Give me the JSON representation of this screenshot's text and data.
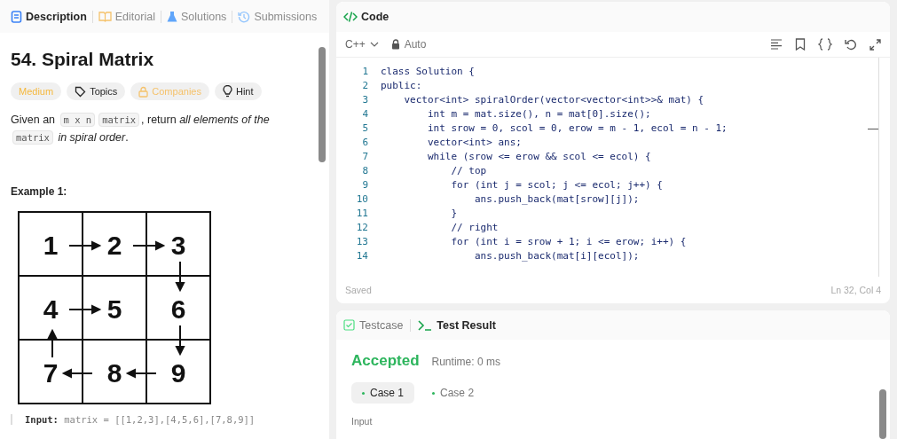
{
  "left_tabs": [
    {
      "label": "Description",
      "selected": true
    },
    {
      "label": "Editorial",
      "selected": false
    },
    {
      "label": "Solutions",
      "selected": false
    },
    {
      "label": "Submissions",
      "selected": false
    }
  ],
  "problem": {
    "title": "54. Spiral Matrix",
    "tags": [
      {
        "label": "Medium",
        "kind": "difficulty"
      },
      {
        "label": "Topics",
        "kind": "tag"
      },
      {
        "label": "Companies",
        "kind": "locked"
      },
      {
        "label": "Hint",
        "kind": "hint"
      }
    ],
    "statement": [
      {
        "t": "Given an ",
        "kind": "text"
      },
      {
        "t": "m x n",
        "kind": "code"
      },
      {
        "t": "matrix",
        "kind": "code"
      },
      {
        "t": ", return ",
        "kind": "text"
      },
      {
        "t": "all elements of the ",
        "kind": "em"
      },
      {
        "t": "matrix",
        "kind": "code"
      },
      {
        "t": " in spiral order",
        "kind": "em"
      },
      {
        "t": ".",
        "kind": "text"
      }
    ],
    "example_title": "Example 1:",
    "matrix": [
      "1",
      "2",
      "3",
      "4",
      "5",
      "6",
      "7",
      "8",
      "9"
    ],
    "input_label": "Input:",
    "input_value": "matrix = [[1,2,3],[4,5,6],[7,8,9]]"
  },
  "code_panel": {
    "title": "Code",
    "language": "C++",
    "mode": "Auto",
    "status": "Saved",
    "cursor": "Ln 32, Col 4",
    "lines": [
      {
        "n": "1",
        "text": "class Solution {"
      },
      {
        "n": "2",
        "text": "public:"
      },
      {
        "n": "3",
        "text": "    vector<int> spiralOrder(vector<vector<int>>& mat) {"
      },
      {
        "n": "4",
        "text": "        int m = mat.size(), n = mat[0].size();"
      },
      {
        "n": "5",
        "text": "        int srow = 0, scol = 0, erow = m - 1, ecol = n - 1;"
      },
      {
        "n": "6",
        "text": "        vector<int> ans;"
      },
      {
        "n": "7",
        "text": "        while (srow <= erow && scol <= ecol) {"
      },
      {
        "n": "8",
        "text": "            // top"
      },
      {
        "n": "9",
        "text": "            for (int j = scol; j <= ecol; j++) {"
      },
      {
        "n": "10",
        "text": "                ans.push_back(mat[srow][j]);"
      },
      {
        "n": "11",
        "text": "            }"
      },
      {
        "n": "12",
        "text": "            // right"
      },
      {
        "n": "13",
        "text": "            for (int i = srow + 1; i <= erow; i++) {"
      },
      {
        "n": "14",
        "text": "                ans.push_back(mat[i][ecol]);"
      }
    ]
  },
  "result_panel": {
    "tabs": [
      {
        "label": "Testcase",
        "selected": false
      },
      {
        "label": "Test Result",
        "selected": true
      }
    ],
    "verdict": "Accepted",
    "runtime": "Runtime: 0 ms",
    "cases": [
      {
        "label": "Case 1",
        "selected": true
      },
      {
        "label": "Case 2",
        "selected": false
      }
    ],
    "input_label": "Input"
  }
}
